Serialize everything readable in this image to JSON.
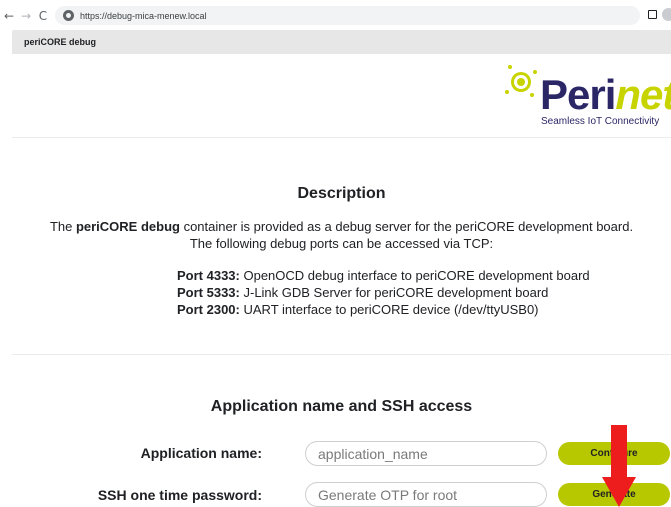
{
  "browser": {
    "url": "https://debug-mica-menew.local",
    "back_icon": "arrow-left-icon",
    "forward_icon": "arrow-right-icon",
    "reload_icon": "reload-icon"
  },
  "app": {
    "title": "periCORE debug"
  },
  "logo": {
    "brand_part1": "Peri",
    "brand_part2": "net",
    "tagline": "Seamless IoT Connectivity",
    "colors": {
      "dark": "#2b2766",
      "accent": "#c8d400"
    }
  },
  "description": {
    "title": "Description",
    "intro_bold": "periCORE debug",
    "intro_prefix": "The ",
    "intro_suffix": " container is provided as a debug server for the periCORE development board.",
    "intro_line2": "The following debug ports can be accessed via TCP:",
    "ports": [
      {
        "label": "Port 4333:",
        "text": " OpenOCD debug interface to periCORE development board"
      },
      {
        "label": "Port 5333:",
        "text": " J-Link GDB Server for periCORE development board"
      },
      {
        "label": "Port 2300:",
        "text": " UART interface to periCORE device (/dev/ttyUSB0)"
      }
    ]
  },
  "access": {
    "title": "Application name and SSH access",
    "app_name_label": "Application name:",
    "app_name_placeholder": "application_name",
    "configure_button": "Configure",
    "ssh_label": "SSH one time password:",
    "ssh_placeholder": "Generate OTP for root",
    "generate_button": "Generate"
  },
  "annotation": {
    "arrow_color": "#ee1d1d"
  }
}
